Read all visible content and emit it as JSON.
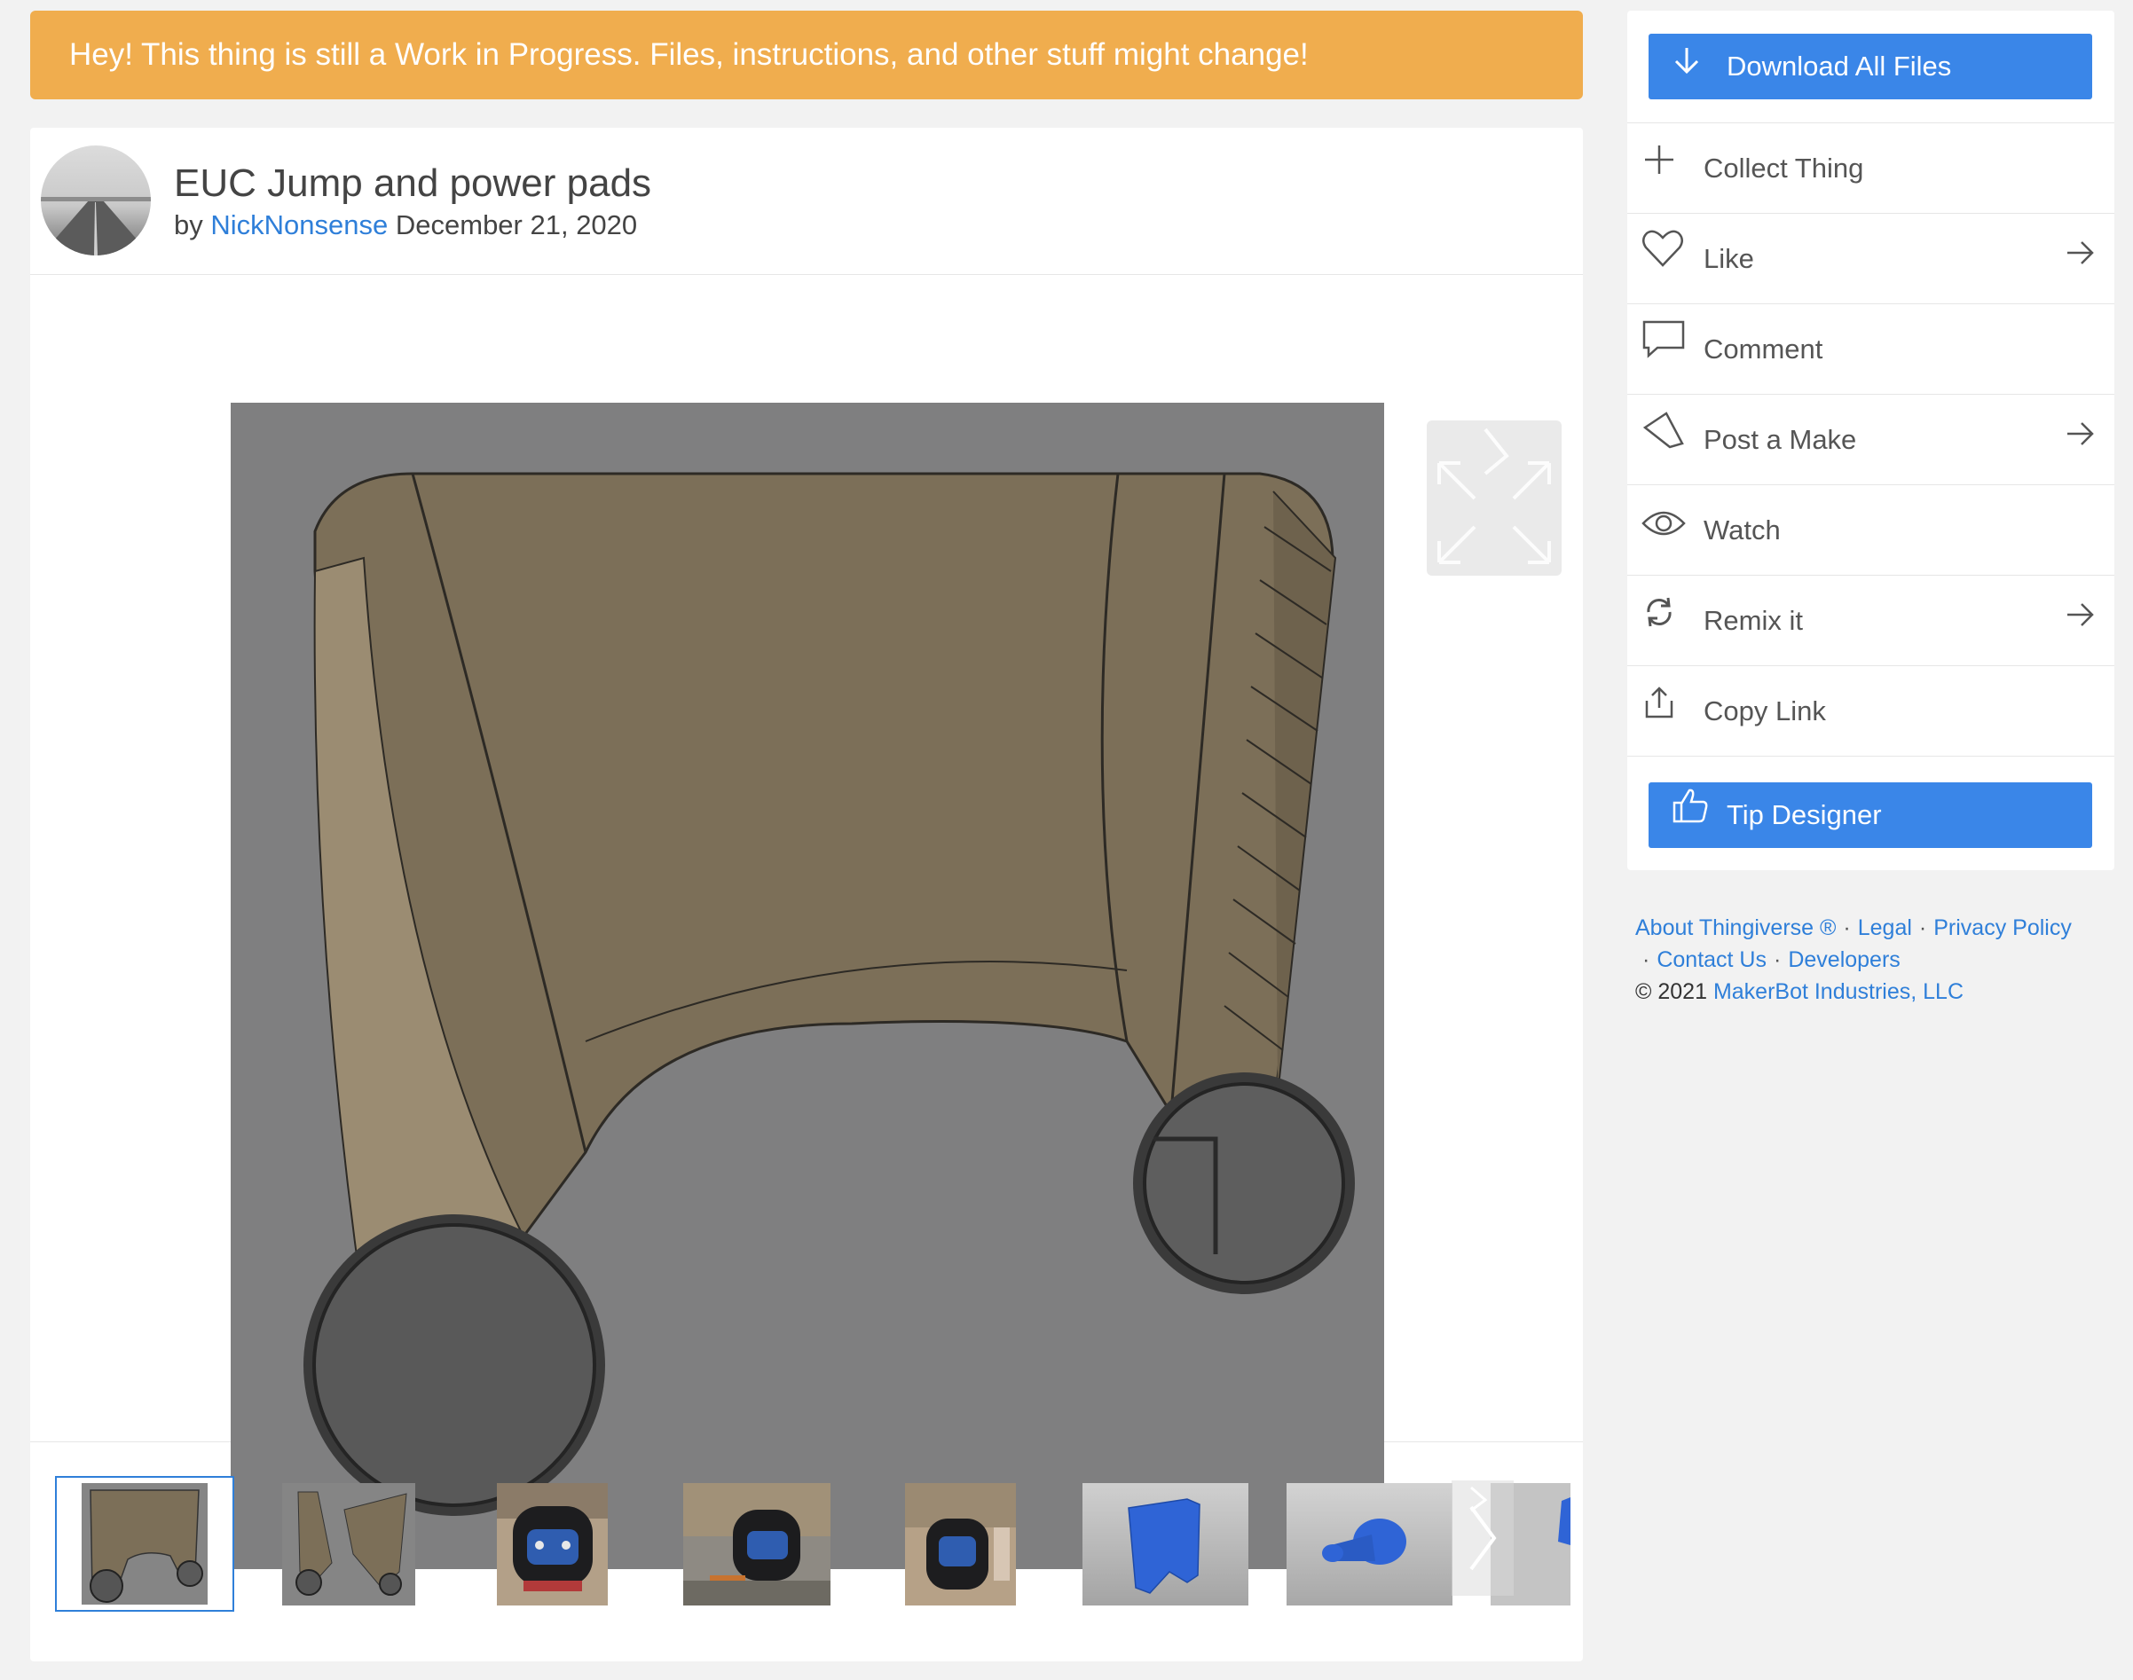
{
  "banner": {
    "text": "Hey! This thing is still a Work in Progress. Files, instructions, and other stuff might change!"
  },
  "thing": {
    "title": "EUC Jump and power pads",
    "by_label": "by",
    "author": "NickNonsense",
    "date": "December 21, 2020"
  },
  "gallery": {
    "selected_index": 0,
    "thumbnails": [
      "thumb-pad-front",
      "thumb-pad-pair",
      "thumb-euc-front",
      "thumb-euc-side",
      "thumb-euc-wall",
      "thumb-blue-pad",
      "thumb-blue-knob",
      "thumb-blue-partial"
    ]
  },
  "sidebar": {
    "download_label": "Download All Files",
    "actions": [
      {
        "label": "Collect Thing",
        "icon": "plus-icon"
      },
      {
        "label": "Like",
        "icon": "heart-icon",
        "arrow": true
      },
      {
        "label": "Comment",
        "icon": "comment-icon"
      },
      {
        "label": "Post a Make",
        "icon": "pencil-icon",
        "arrow": true
      },
      {
        "label": "Watch",
        "icon": "eye-icon"
      },
      {
        "label": "Remix it",
        "icon": "remix-icon",
        "arrow": true
      },
      {
        "label": "Copy Link",
        "icon": "share-icon"
      }
    ],
    "tip_label": "Tip Designer"
  },
  "footer": {
    "about": "About Thingiverse ®",
    "legal": "Legal",
    "privacy": "Privacy Policy",
    "contact": "Contact Us",
    "developers": "Developers",
    "copyright": "©  2021",
    "company": "MakerBot Industries, LLC"
  },
  "colors": {
    "banner": "#f0ad4e",
    "primary": "#3a86e8",
    "link": "#2f7fd9"
  }
}
